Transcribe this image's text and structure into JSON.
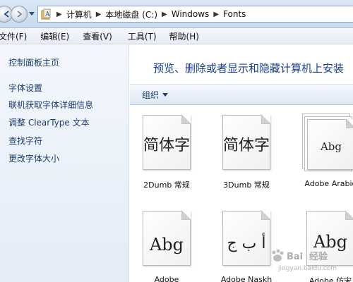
{
  "address_bar": {
    "crumbs": [
      "计算机",
      "本地磁盘 (C:)",
      "Windows",
      "Fonts"
    ]
  },
  "menu": {
    "file": "文件(F)",
    "edit": "编辑(E)",
    "view": "查看(V)",
    "tools": "工具(T)",
    "help": "帮助(H)"
  },
  "sidebar": {
    "home": "控制面板主页",
    "font_settings": "字体设置",
    "online_info": "联机获取字体详细信息",
    "cleartype": "调整 ClearType 文本",
    "find_char": "查找字符",
    "change_size": "更改字体大小"
  },
  "main": {
    "heading": "预览、删除或者显示和隐藏计算机上安装",
    "organize_label": "组织"
  },
  "fonts": [
    {
      "preview": "简体字",
      "label": "2Dumb 常规",
      "stacked": false
    },
    {
      "preview": "简体字",
      "label": "3Dumb 常规",
      "stacked": false
    },
    {
      "preview": "Abg",
      "label": "Adobe Arabic",
      "stacked": true
    },
    {
      "preview": "Abg",
      "label": "Adobe",
      "stacked": false
    },
    {
      "preview": "أ ب ج",
      "label": "Adobe Naskh",
      "stacked": false
    },
    {
      "preview": "Abg",
      "label": "Adobe 仿宋",
      "stacked": false
    }
  ],
  "watermark": {
    "logo_text": "Baidu 经验",
    "sub_text": "jingyan.baidu.com"
  }
}
